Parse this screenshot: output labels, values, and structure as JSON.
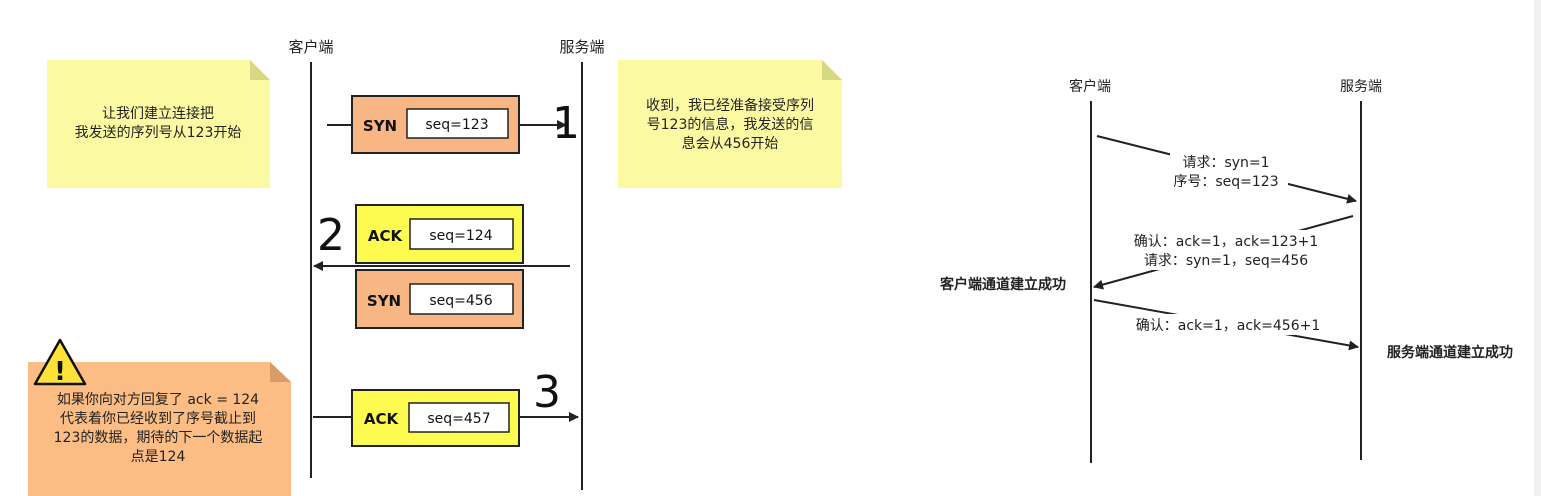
{
  "left": {
    "client_label": "客户端",
    "server_label": "服务端",
    "note1": [
      "让我们建立连接把",
      "我发送的序列号从123开始"
    ],
    "note2": [
      "收到，我已经准备接受序列",
      "号123的信息，我发送的信",
      "息会从456开始"
    ],
    "note3": [
      "如果你向对方回复了 ack = 124",
      "代表着你已经收到了序号截止到",
      "123的数据，期待的下一个数据起",
      "点是124"
    ],
    "step1": {
      "number": "1",
      "type": "SYN",
      "seq": "seq=123"
    },
    "step2": {
      "number": "2",
      "ack_type": "ACK",
      "ack_seq": "seq=124",
      "syn_type": "SYN",
      "syn_seq": "seq=456"
    },
    "step3": {
      "number": "3",
      "type": "ACK",
      "seq": "seq=457"
    },
    "warning_mark": "!"
  },
  "right": {
    "client_label": "客户端",
    "server_label": "服务端",
    "msg1": [
      "请求：syn=1",
      "序号：seq=123"
    ],
    "msg2": [
      "确认：ack=1，ack=123+1",
      "请求：syn=1，seq=456"
    ],
    "msg3": [
      "确认：ack=1，ack=456+1"
    ],
    "client_established": "客户端通道建立成功",
    "server_established": "服务端通道建立成功"
  },
  "colors": {
    "note_yellow": "#fbfaa2",
    "note_orange": "#fbbd84",
    "packet_syn": "#f7b683",
    "packet_ack": "#fdfb4f",
    "line": "#222222"
  }
}
